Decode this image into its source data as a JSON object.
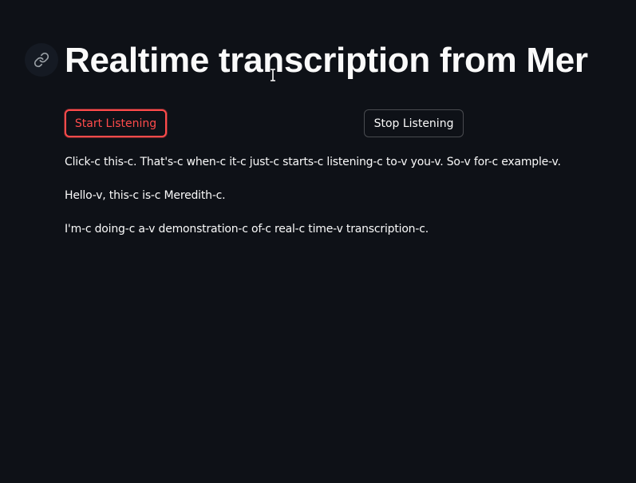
{
  "header": {
    "title": "Realtime transcription from Mer",
    "link_icon": "link-icon"
  },
  "controls": {
    "start_label": "Start Listening",
    "stop_label": "Stop Listening"
  },
  "transcript": [
    "Click-c this-c. That's-c when-c it-c just-c starts-c listening-c to-v you-v. So-v for-c example-v.",
    "Hello-v, this-c is-c Meredith-c.",
    "I'm-c doing-c a-v demonstration-c of-c real-c time-v transcription-c."
  ],
  "colors": {
    "background": "#0e1117",
    "text": "#fafafa",
    "accent": "#ff4b4b"
  }
}
